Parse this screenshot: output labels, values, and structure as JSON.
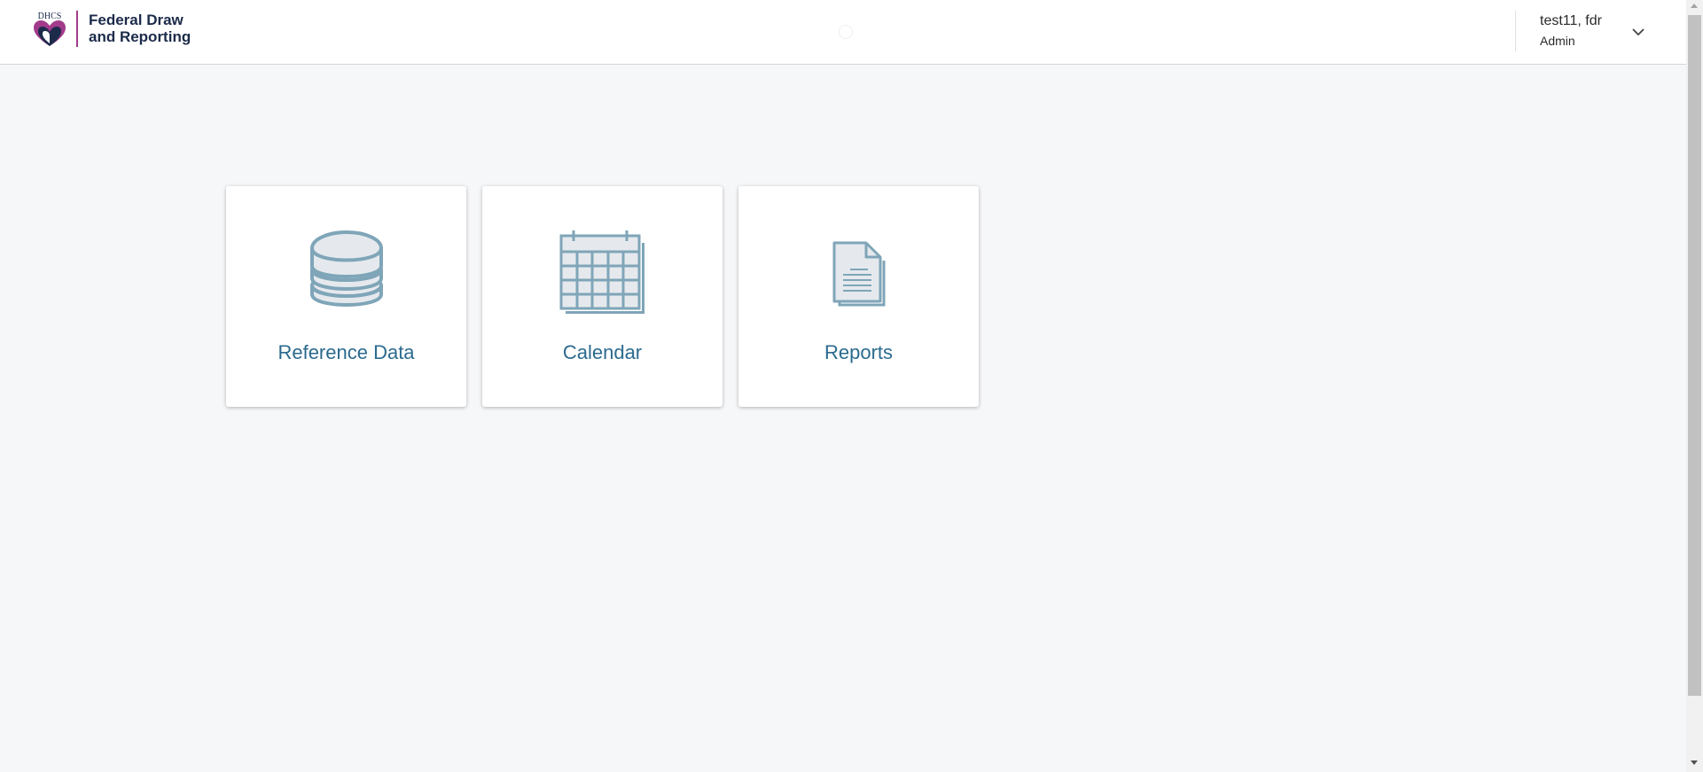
{
  "header": {
    "logo_text": "DHCS",
    "app_title": "Federal Draw\nand Reporting"
  },
  "user": {
    "name": "test11, fdr",
    "role": "Admin"
  },
  "cards": [
    {
      "label": "Reference Data",
      "icon": "database-icon"
    },
    {
      "label": "Calendar",
      "icon": "calendar-icon"
    },
    {
      "label": "Reports",
      "icon": "document-icon"
    }
  ],
  "colors": {
    "accent": "#2b6a8e",
    "icon": "#7fa5b8",
    "brand_magenta": "#a23b8b",
    "brand_navy": "#1c2b4a",
    "background": "#f6f7f9"
  }
}
